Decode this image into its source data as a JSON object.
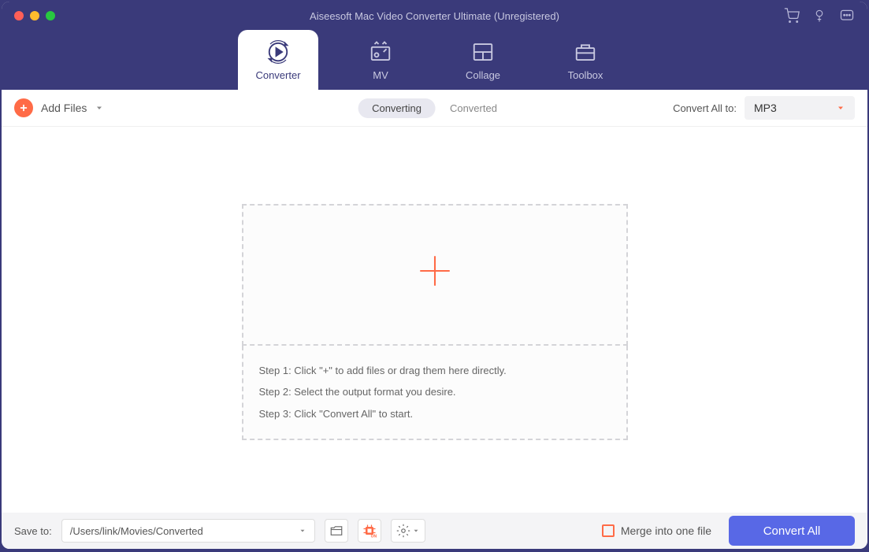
{
  "titlebar": {
    "title": "Aiseesoft Mac Video Converter Ultimate (Unregistered)"
  },
  "tabs": {
    "converter": "Converter",
    "mv": "MV",
    "collage": "Collage",
    "toolbox": "Toolbox"
  },
  "toolbar": {
    "add_files": "Add Files",
    "converting": "Converting",
    "converted": "Converted",
    "convert_all_to": "Convert All to:",
    "format": "MP3"
  },
  "dropzone": {
    "step1": "Step 1: Click \"+\" to add files or drag them here directly.",
    "step2": "Step 2: Select the output format you desire.",
    "step3": "Step 3: Click \"Convert All\" to start."
  },
  "footer": {
    "save_to": "Save to:",
    "path": "/Users/link/Movies/Converted",
    "merge": "Merge into one file",
    "convert_all": "Convert All"
  }
}
